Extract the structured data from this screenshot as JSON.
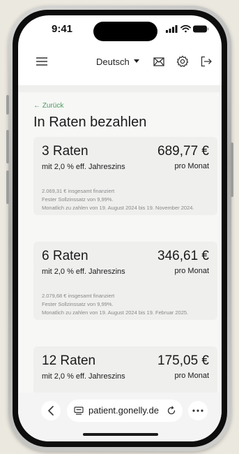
{
  "status_bar": {
    "time": "9:41"
  },
  "navbar": {
    "language": "Deutsch"
  },
  "page": {
    "back_label": "← Zurück",
    "title": "In Raten bezahlen"
  },
  "plans": [
    {
      "count": "3 Raten",
      "amount": "689,77 €",
      "rate": "mit 2,0 % eff. Jahreszins",
      "per": "pro Monat",
      "financed": "2.069,31 € insgesamt finanziert",
      "fixed_rate": "Fester Sollzinssatz von 9,99%.",
      "schedule": "Monatlich zu zahlen von 19. August 2024 bis 19. November 2024."
    },
    {
      "count": "6 Raten",
      "amount": "346,61 €",
      "rate": "mit 2,0 % eff. Jahreszins",
      "per": "pro Monat",
      "financed": "2.079,68 € insgesamt finanziert",
      "fixed_rate": "Fester Sollzinssatz von 9,99%.",
      "schedule": "Monatlich zu zahlen von 19. August 2024 bis 19. Februar 2025."
    },
    {
      "count": "12 Raten",
      "amount": "175,05 €",
      "rate": "mit 2,0 % eff. Jahreszins",
      "per": "pro Monat"
    }
  ],
  "browser": {
    "url": "patient.gonelly.de"
  },
  "colors": {
    "accent_green": "#4a9a5e",
    "card_bg": "#efefee",
    "page_bg": "#ebe8df"
  }
}
